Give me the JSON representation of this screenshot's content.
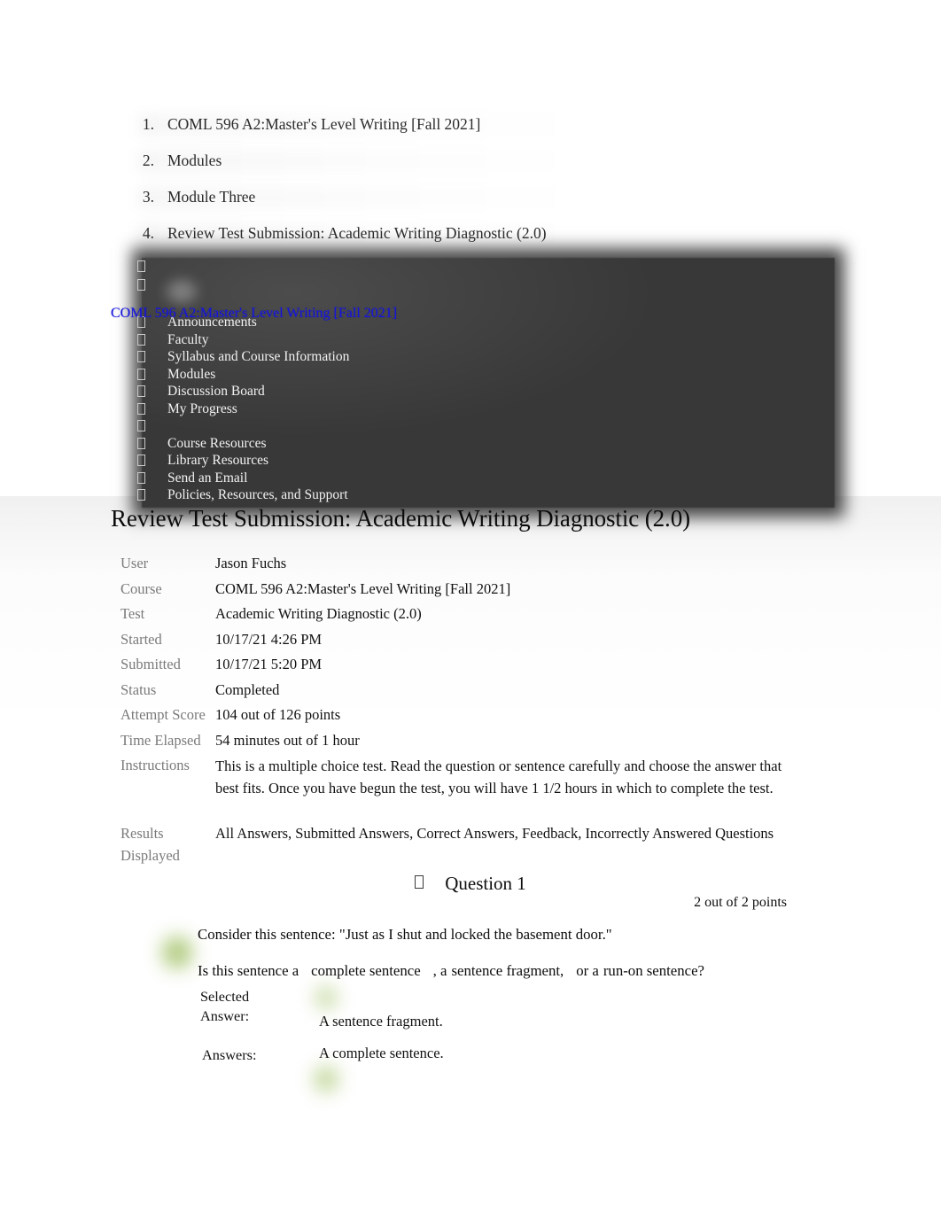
{
  "breadcrumb": {
    "items": [
      {
        "num": "1.",
        "label": "COML 596 A2:Master's Level Writing [Fall 2021]"
      },
      {
        "num": "2.",
        "label": "Modules"
      },
      {
        "num": "3.",
        "label": "Module Three"
      },
      {
        "num": "4.",
        "label": "Review Test Submission: Academic Writing Diagnostic (2.0)"
      }
    ]
  },
  "course_menu": {
    "course_link": "COML 596 A2:Master's Level Writing [Fall 2021]",
    "items": [
      "Announcements",
      "Faculty",
      "Syllabus and Course Information",
      "Modules",
      "Discussion Board",
      "My Progress",
      "",
      "Course Resources",
      "Library Resources",
      "Send an Email",
      "Policies, Resources, and Support"
    ]
  },
  "page": {
    "heading": "Review Test Submission: Academic Writing Diagnostic (2.0)"
  },
  "details": [
    {
      "label": "User",
      "value": "Jason Fuchs"
    },
    {
      "label": "Course",
      "value": "COML 596 A2:Master's Level Writing [Fall 2021]"
    },
    {
      "label": "Test",
      "value": "Academic Writing Diagnostic (2.0)"
    },
    {
      "label": "Started",
      "value": "10/17/21 4:26 PM"
    },
    {
      "label": "Submitted",
      "value": "10/17/21 5:20 PM"
    },
    {
      "label": "Status",
      "value": "Completed"
    },
    {
      "label": "Attempt Score",
      "value": "104 out of 126 points"
    },
    {
      "label": "Time Elapsed",
      "value": "54 minutes out of 1 hour"
    },
    {
      "label": "Instructions",
      "value": "This is a multiple choice test. Read the question or sentence carefully and choose the answer that best fits. Once you have begun the test, you will have 1 1/2 hours in which to complete the test."
    },
    {
      "label": "Results Displayed",
      "value": "All Answers, Submitted Answers, Correct Answers, Feedback, Incorrectly Answered Questions"
    }
  ],
  "question": {
    "title": "Question 1",
    "points": "2 out of 2 points",
    "stem_line1": "Consider this sentence: \"Just as I shut and locked the basement door.\"",
    "stem_line2_a": "Is this sentence a",
    "stem_line2_b": "complete sentence",
    "stem_line2_c": ", a",
    "stem_line2_d": "sentence fragment,",
    "stem_line2_e": "or a",
    "stem_line2_f": "run-on sentence?",
    "selected_answer_label": "Selected Answer:",
    "selected_answer_value": "A sentence fragment.",
    "answers_label": "Answers:",
    "answers_value": "A complete sentence."
  },
  "colors": {
    "panel_background": "#383838",
    "link_blue": "#1414dd",
    "label_gray": "#7a7a7a",
    "marker_green": "#9fbf62"
  }
}
